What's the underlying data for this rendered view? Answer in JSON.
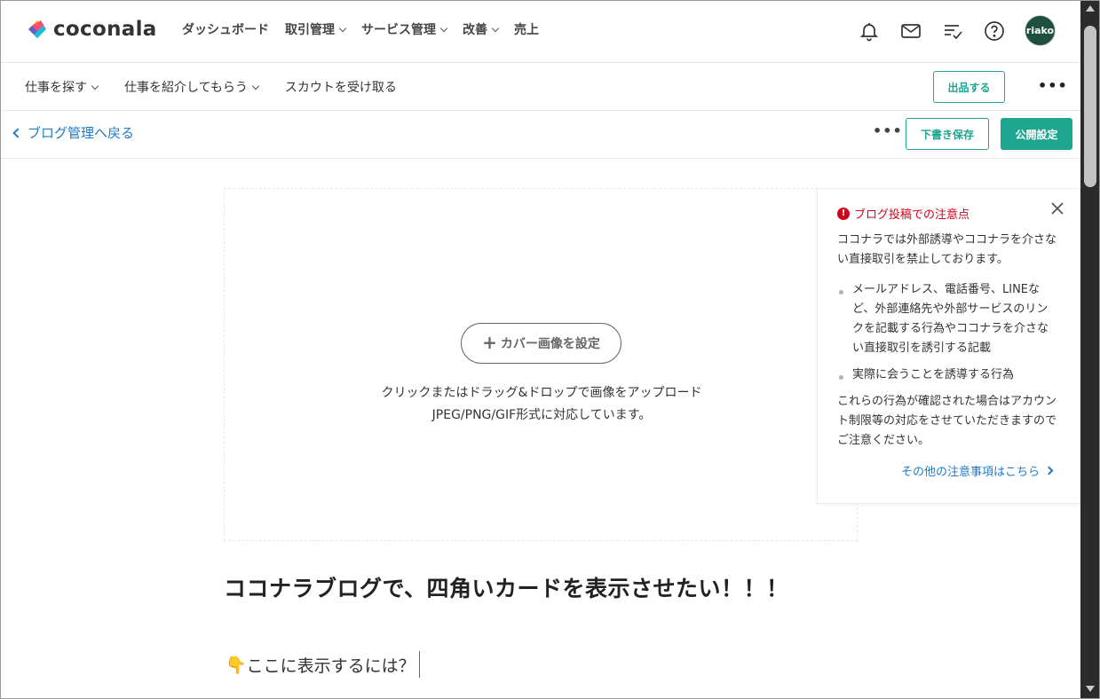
{
  "app": {
    "logo_text": "coconala"
  },
  "main_nav": [
    {
      "label": "ダッシュボード",
      "dropdown": false
    },
    {
      "label": "取引管理",
      "dropdown": true
    },
    {
      "label": "サービス管理",
      "dropdown": true
    },
    {
      "label": "改善",
      "dropdown": true
    },
    {
      "label": "売上",
      "dropdown": false
    }
  ],
  "header_icons": [
    "bell-icon",
    "mail-icon",
    "checklist-icon",
    "help-icon"
  ],
  "user": {
    "avatar_text": "riako"
  },
  "sub_nav": [
    {
      "label": "仕事を探す",
      "dropdown": true
    },
    {
      "label": "仕事を紹介してもらう",
      "dropdown": true
    },
    {
      "label": "スカウトを受け取る",
      "dropdown": false
    }
  ],
  "sub_actions": {
    "sell_label": "出品する",
    "more_label": "•••"
  },
  "editor_bar": {
    "back_label": "ブログ管理へ戻る",
    "more_label": "•••",
    "draft_label": "下書き保存",
    "publish_label": "公開設定"
  },
  "cover": {
    "button_label": "カバー画像を設定",
    "hint_line1": "クリックまたはドラッグ&ドロップで画像をアップロード",
    "hint_line2": "JPEG/PNG/GIF形式に対応しています。"
  },
  "notice": {
    "title": "ブログ投稿での注意点",
    "intro": "ココナラでは外部誘導やココナラを介さない直接取引を禁止しております。",
    "items": [
      "メールアドレス、電話番号、LINEなど、外部連絡先や外部サービスのリンクを記載する行為やココナラを介さない直接取引を誘引する記載",
      "実際に会うことを誘導する行為"
    ],
    "outro": "これらの行為が確認された場合はアカウント制限等の対応をさせていただきますのでご注意ください。",
    "link_label": "その他の注意事項はこちら"
  },
  "article": {
    "title": "ココナラブログで、四角いカードを表示させたい！！！",
    "line1_emoji": "👇",
    "line1_text": "ここに表示するには？"
  },
  "colors": {
    "brand_green": "#1ea58f",
    "link_blue": "#1f7bc4",
    "warning_red": "#d0021b",
    "avatar_bg": "#1f4f3d"
  }
}
